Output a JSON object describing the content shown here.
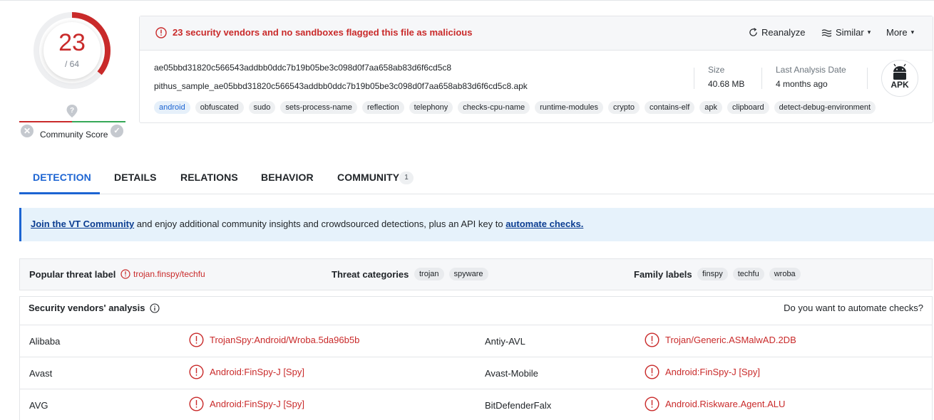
{
  "score": {
    "detections": "23",
    "total": "/ 64",
    "fraction": 0.359,
    "color": "#c92a2a"
  },
  "community": {
    "label": "Community Score"
  },
  "alert": {
    "text": "23 security vendors and no sandboxes flagged this file as malicious"
  },
  "actions": {
    "reanalyze": "Reanalyze",
    "similar": "Similar",
    "more": "More"
  },
  "file": {
    "hash": "ae05bbd31820c566543addbb0ddc7b19b05be3c098d0f7aa658ab83d6f6cd5c8",
    "name": "pithus_sample_ae05bbd31820c566543addbb0ddc7b19b05be3c098d0f7aa658ab83d6f6cd5c8.apk",
    "tags": [
      "android",
      "obfuscated",
      "sudo",
      "sets-process-name",
      "reflection",
      "telephony",
      "checks-cpu-name",
      "runtime-modules",
      "crypto",
      "contains-elf",
      "apk",
      "clipboard",
      "detect-debug-environment"
    ],
    "size_label": "Size",
    "size_value": "40.68 MB",
    "date_label": "Last Analysis Date",
    "date_value": "4 months ago",
    "type_badge": "APK"
  },
  "tabs": {
    "detection": "DETECTION",
    "details": "DETAILS",
    "relations": "RELATIONS",
    "behavior": "BEHAVIOR",
    "community": "COMMUNITY",
    "community_count": "1"
  },
  "banner": {
    "join_link": "Join the VT Community",
    "middle": " and enjoy additional community insights and crowdsourced detections, plus an API key to ",
    "automate_link": "automate checks."
  },
  "summary": {
    "popular_label": "Popular threat label",
    "popular_value": "trojan.finspy/techfu",
    "categories_label": "Threat categories",
    "categories": [
      "trojan",
      "spyware"
    ],
    "family_label": "Family labels",
    "families": [
      "finspy",
      "techfu",
      "wroba"
    ]
  },
  "vendors": {
    "title": "Security vendors' analysis",
    "automate_prompt": "Do you want to automate checks?",
    "rows": [
      {
        "left_vendor": "Alibaba",
        "left_result": "TrojanSpy:Android/Wroba.5da96b5b",
        "right_vendor": "Antiy-AVL",
        "right_result": "Trojan/Generic.ASMalwAD.2DB"
      },
      {
        "left_vendor": "Avast",
        "left_result": "Android:FinSpy-J [Spy]",
        "right_vendor": "Avast-Mobile",
        "right_result": "Android:FinSpy-J [Spy]"
      },
      {
        "left_vendor": "AVG",
        "left_result": "Android:FinSpy-J [Spy]",
        "right_vendor": "BitDefenderFalx",
        "right_result": "Android.Riskware.Agent.ALU"
      }
    ]
  }
}
